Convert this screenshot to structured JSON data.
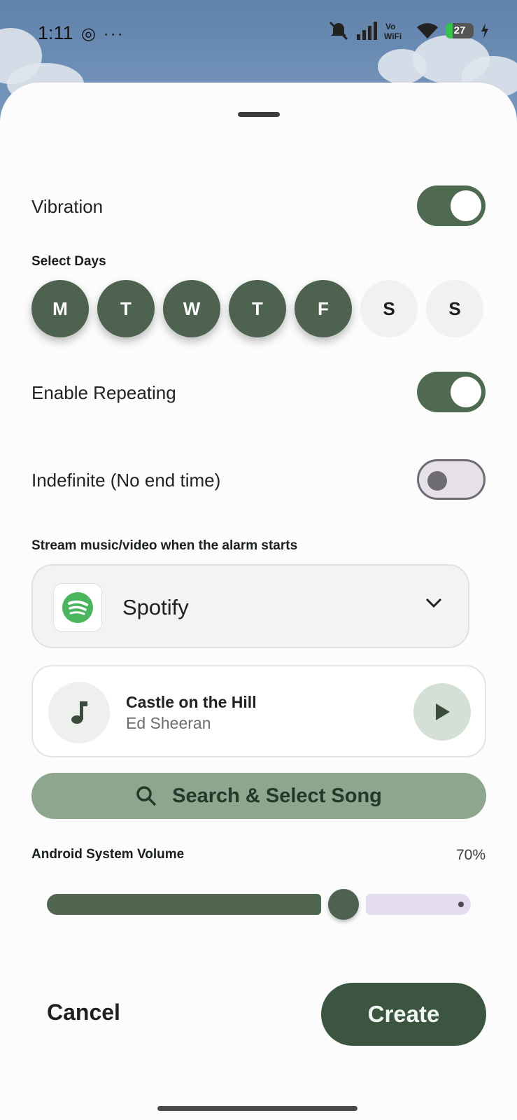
{
  "status": {
    "time": "1:11",
    "left_icons": "◎ ···",
    "battery": "27",
    "right_icons": [
      "bell-off-icon",
      "signal-icon",
      "vowifi-icon",
      "wifi-icon",
      "battery-icon",
      "charging-icon"
    ]
  },
  "settings": {
    "vibration": {
      "label": "Vibration",
      "on": true
    },
    "select_days_title": "Select Days",
    "days": [
      {
        "letter": "M",
        "selected": true
      },
      {
        "letter": "T",
        "selected": true
      },
      {
        "letter": "W",
        "selected": true
      },
      {
        "letter": "T",
        "selected": true
      },
      {
        "letter": "F",
        "selected": true
      },
      {
        "letter": "S",
        "selected": false
      },
      {
        "letter": "S",
        "selected": false
      }
    ],
    "repeating": {
      "label": "Enable Repeating",
      "on": true
    },
    "indefinite": {
      "label": "Indefinite (No end time)",
      "on": false
    }
  },
  "stream": {
    "title": "Stream music/video when the alarm starts",
    "app": "Spotify",
    "app_icon": "spotify-icon"
  },
  "song": {
    "title": "Castle on the Hill",
    "artist": "Ed Sheeran"
  },
  "search_button": "Search & Select Song",
  "volume": {
    "title": "Android System Volume",
    "value_label": "70%",
    "level": 0.7
  },
  "actions": {
    "cancel": "Cancel",
    "create": "Create"
  },
  "colors": {
    "accent": "#4e634f",
    "create": "#3c5540",
    "search": "#8ea68d"
  }
}
